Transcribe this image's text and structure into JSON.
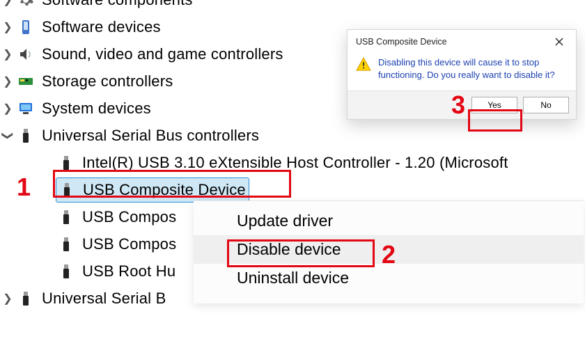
{
  "tree": {
    "items": [
      {
        "label": "Software components",
        "expand": "collapsed",
        "icon": "gear"
      },
      {
        "label": "Software devices",
        "expand": "collapsed",
        "icon": "device"
      },
      {
        "label": "Sound, video and game controllers",
        "expand": "collapsed",
        "icon": "speaker"
      },
      {
        "label": "Storage controllers",
        "expand": "collapsed",
        "icon": "storage"
      },
      {
        "label": "System devices",
        "expand": "collapsed",
        "icon": "computer"
      },
      {
        "label": "Universal Serial Bus controllers",
        "expand": "expanded",
        "icon": "usb",
        "children": [
          {
            "label": "Intel(R) USB 3.10 eXtensible Host Controller - 1.20 (Microsoft",
            "icon": "usb"
          },
          {
            "label": "USB Composite Device",
            "icon": "usb",
            "selected": true
          },
          {
            "label": "USB Compos",
            "icon": "usb"
          },
          {
            "label": "USB Compos",
            "icon": "usb"
          },
          {
            "label": "USB Root Hu",
            "icon": "usb"
          }
        ]
      },
      {
        "label": "Universal Serial B",
        "expand": "collapsed",
        "icon": "usb"
      }
    ]
  },
  "context_menu": {
    "items": [
      {
        "label": "Update driver"
      },
      {
        "label": "Disable device",
        "hover": true
      },
      {
        "label": "Uninstall device"
      }
    ]
  },
  "dialog": {
    "title": "USB Composite Device",
    "message": "Disabling this device will cause it to stop functioning. Do you really want to disable it?",
    "yes": "Yes",
    "no": "No"
  },
  "annotations": {
    "step1": "1",
    "step2": "2",
    "step3": "3"
  }
}
